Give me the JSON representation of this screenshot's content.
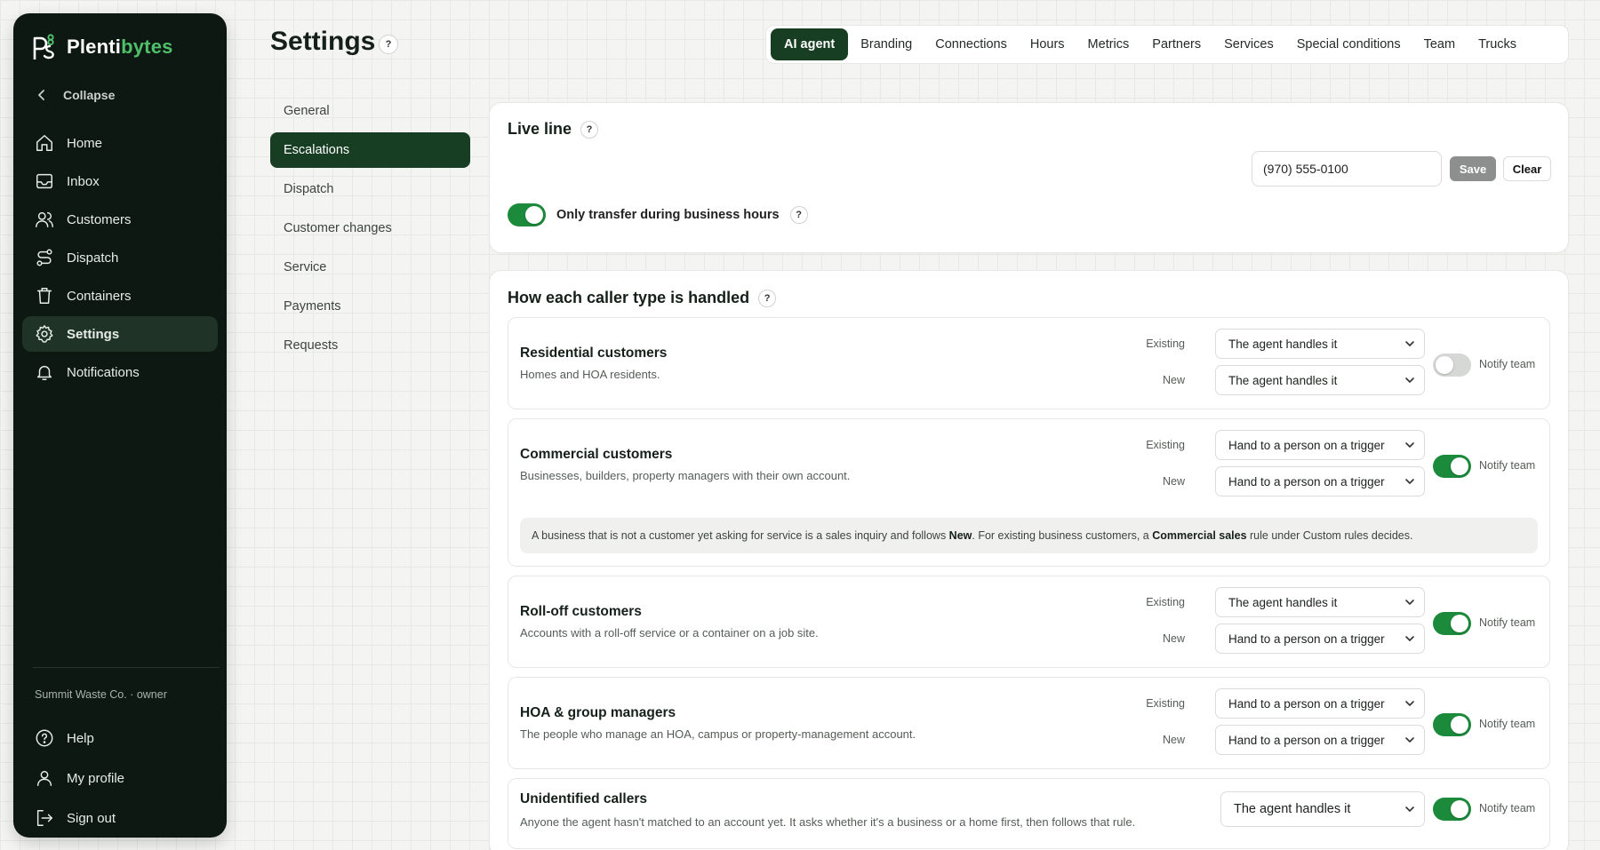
{
  "app": {
    "brand_a": "Plenti",
    "brand_b": "bytes"
  },
  "sidebar": {
    "collapse_label": "Collapse",
    "items": [
      {
        "label": "Home",
        "icon": "home-icon"
      },
      {
        "label": "Inbox",
        "icon": "inbox-icon"
      },
      {
        "label": "Customers",
        "icon": "users-icon"
      },
      {
        "label": "Dispatch",
        "icon": "route-icon"
      },
      {
        "label": "Containers",
        "icon": "trash-icon"
      },
      {
        "label": "Settings",
        "icon": "gear-icon",
        "active": true
      },
      {
        "label": "Notifications",
        "icon": "bell-icon"
      }
    ],
    "org_line": "Summit Waste Co. · owner",
    "bottom_items": [
      {
        "label": "Help",
        "icon": "help-circle-icon"
      },
      {
        "label": "My profile",
        "icon": "user-icon"
      },
      {
        "label": "Sign out",
        "icon": "logout-icon"
      }
    ]
  },
  "header": {
    "title": "Settings",
    "help": "?",
    "tabs": [
      "AI agent",
      "Branding",
      "Connections",
      "Hours",
      "Metrics",
      "Partners",
      "Services",
      "Special conditions",
      "Team",
      "Trucks"
    ],
    "active_tab": "AI agent"
  },
  "subnav": {
    "items": [
      "General",
      "Escalations",
      "Dispatch",
      "Customer changes",
      "Service",
      "Payments",
      "Requests"
    ],
    "active": "Escalations"
  },
  "live_line": {
    "title": "Live line",
    "help": "?",
    "phone_value": "(970) 555-0100",
    "save_label": "Save",
    "clear_label": "Clear",
    "business_hours_label": "Only transfer during business hours",
    "business_hours_on": true
  },
  "callers": {
    "title": "How each caller type is handled",
    "help": "?",
    "existing_label": "Existing",
    "new_label": "New",
    "notify_label": "Notify team",
    "types": [
      {
        "name": "Residential customers",
        "desc": "Homes and HOA residents.",
        "existing": "The agent handles it",
        "new": "The agent handles it",
        "notify": false
      },
      {
        "name": "Commercial customers",
        "desc": "Businesses, builders, property managers with their own account.",
        "existing": "Hand to a person on a trigger",
        "new": "Hand to a person on a trigger",
        "notify": true,
        "note": {
          "part1": "A business that is not a customer yet asking for service is a sales inquiry and follows ",
          "bold1": "New",
          "part2": ". For existing business customers, a ",
          "bold2": "Commercial sales",
          "part3": " rule under Custom rules decides."
        }
      },
      {
        "name": "Roll-off customers",
        "desc": "Accounts with a roll-off service or a container on a job site.",
        "existing": "The agent handles it",
        "new": "Hand to a person on a trigger",
        "notify": true
      },
      {
        "name": "HOA & group managers",
        "desc": "The people who manage an HOA, campus or property-management account.",
        "existing": "Hand to a person on a trigger",
        "new": "Hand to a person on a trigger",
        "notify": true
      },
      {
        "name": "Unidentified callers",
        "desc": "Anyone the agent hasn't matched to an account yet. It asks whether it's a business or a home first, then follows that rule.",
        "single": "The agent handles it",
        "notify": true
      }
    ]
  }
}
